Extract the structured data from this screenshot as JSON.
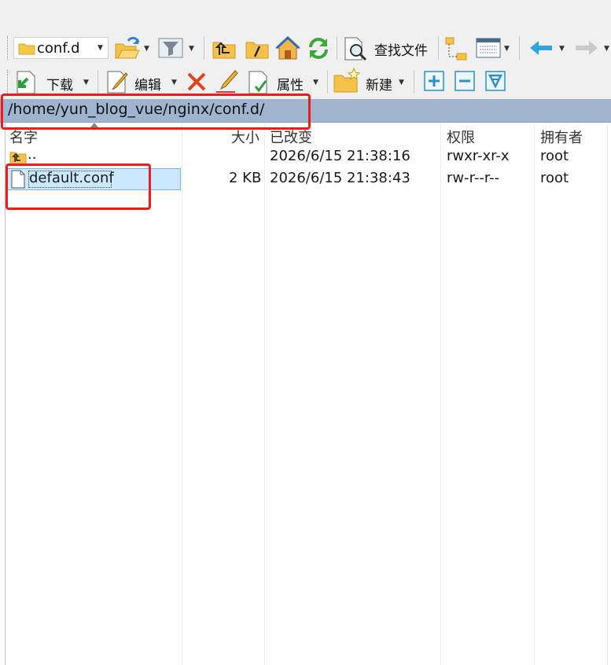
{
  "toolbar": {
    "folder_combo": {
      "value": "conf.d"
    },
    "find_files_label": "查找文件",
    "download_label": "下载",
    "edit_label": "编辑",
    "properties_label": "属性",
    "new_label": "新建"
  },
  "path_bar": {
    "path": "/home/yun_blog_vue/nginx/conf.d/"
  },
  "file_list": {
    "columns": {
      "name": "名字",
      "size": "大小",
      "modified": "已改变",
      "permissions": "权限",
      "owner": "拥有者"
    },
    "rows": [
      {
        "name": "..",
        "size": "",
        "modified": "2026/6/15 21:38:16",
        "permissions": "rwxr-xr-x",
        "owner": "root",
        "icon": "parent-folder-icon",
        "selected": false
      },
      {
        "name": "default.conf",
        "size": "2 KB",
        "modified": "2026/6/15 21:38:43",
        "permissions": "rw-r--r--",
        "owner": "root",
        "icon": "file-icon",
        "selected": true
      }
    ]
  },
  "colors": {
    "highlight_annotation": "#ee1c1c",
    "path_bar_bg": "#9fb5cf",
    "selection_bg": "#cce8ff"
  }
}
